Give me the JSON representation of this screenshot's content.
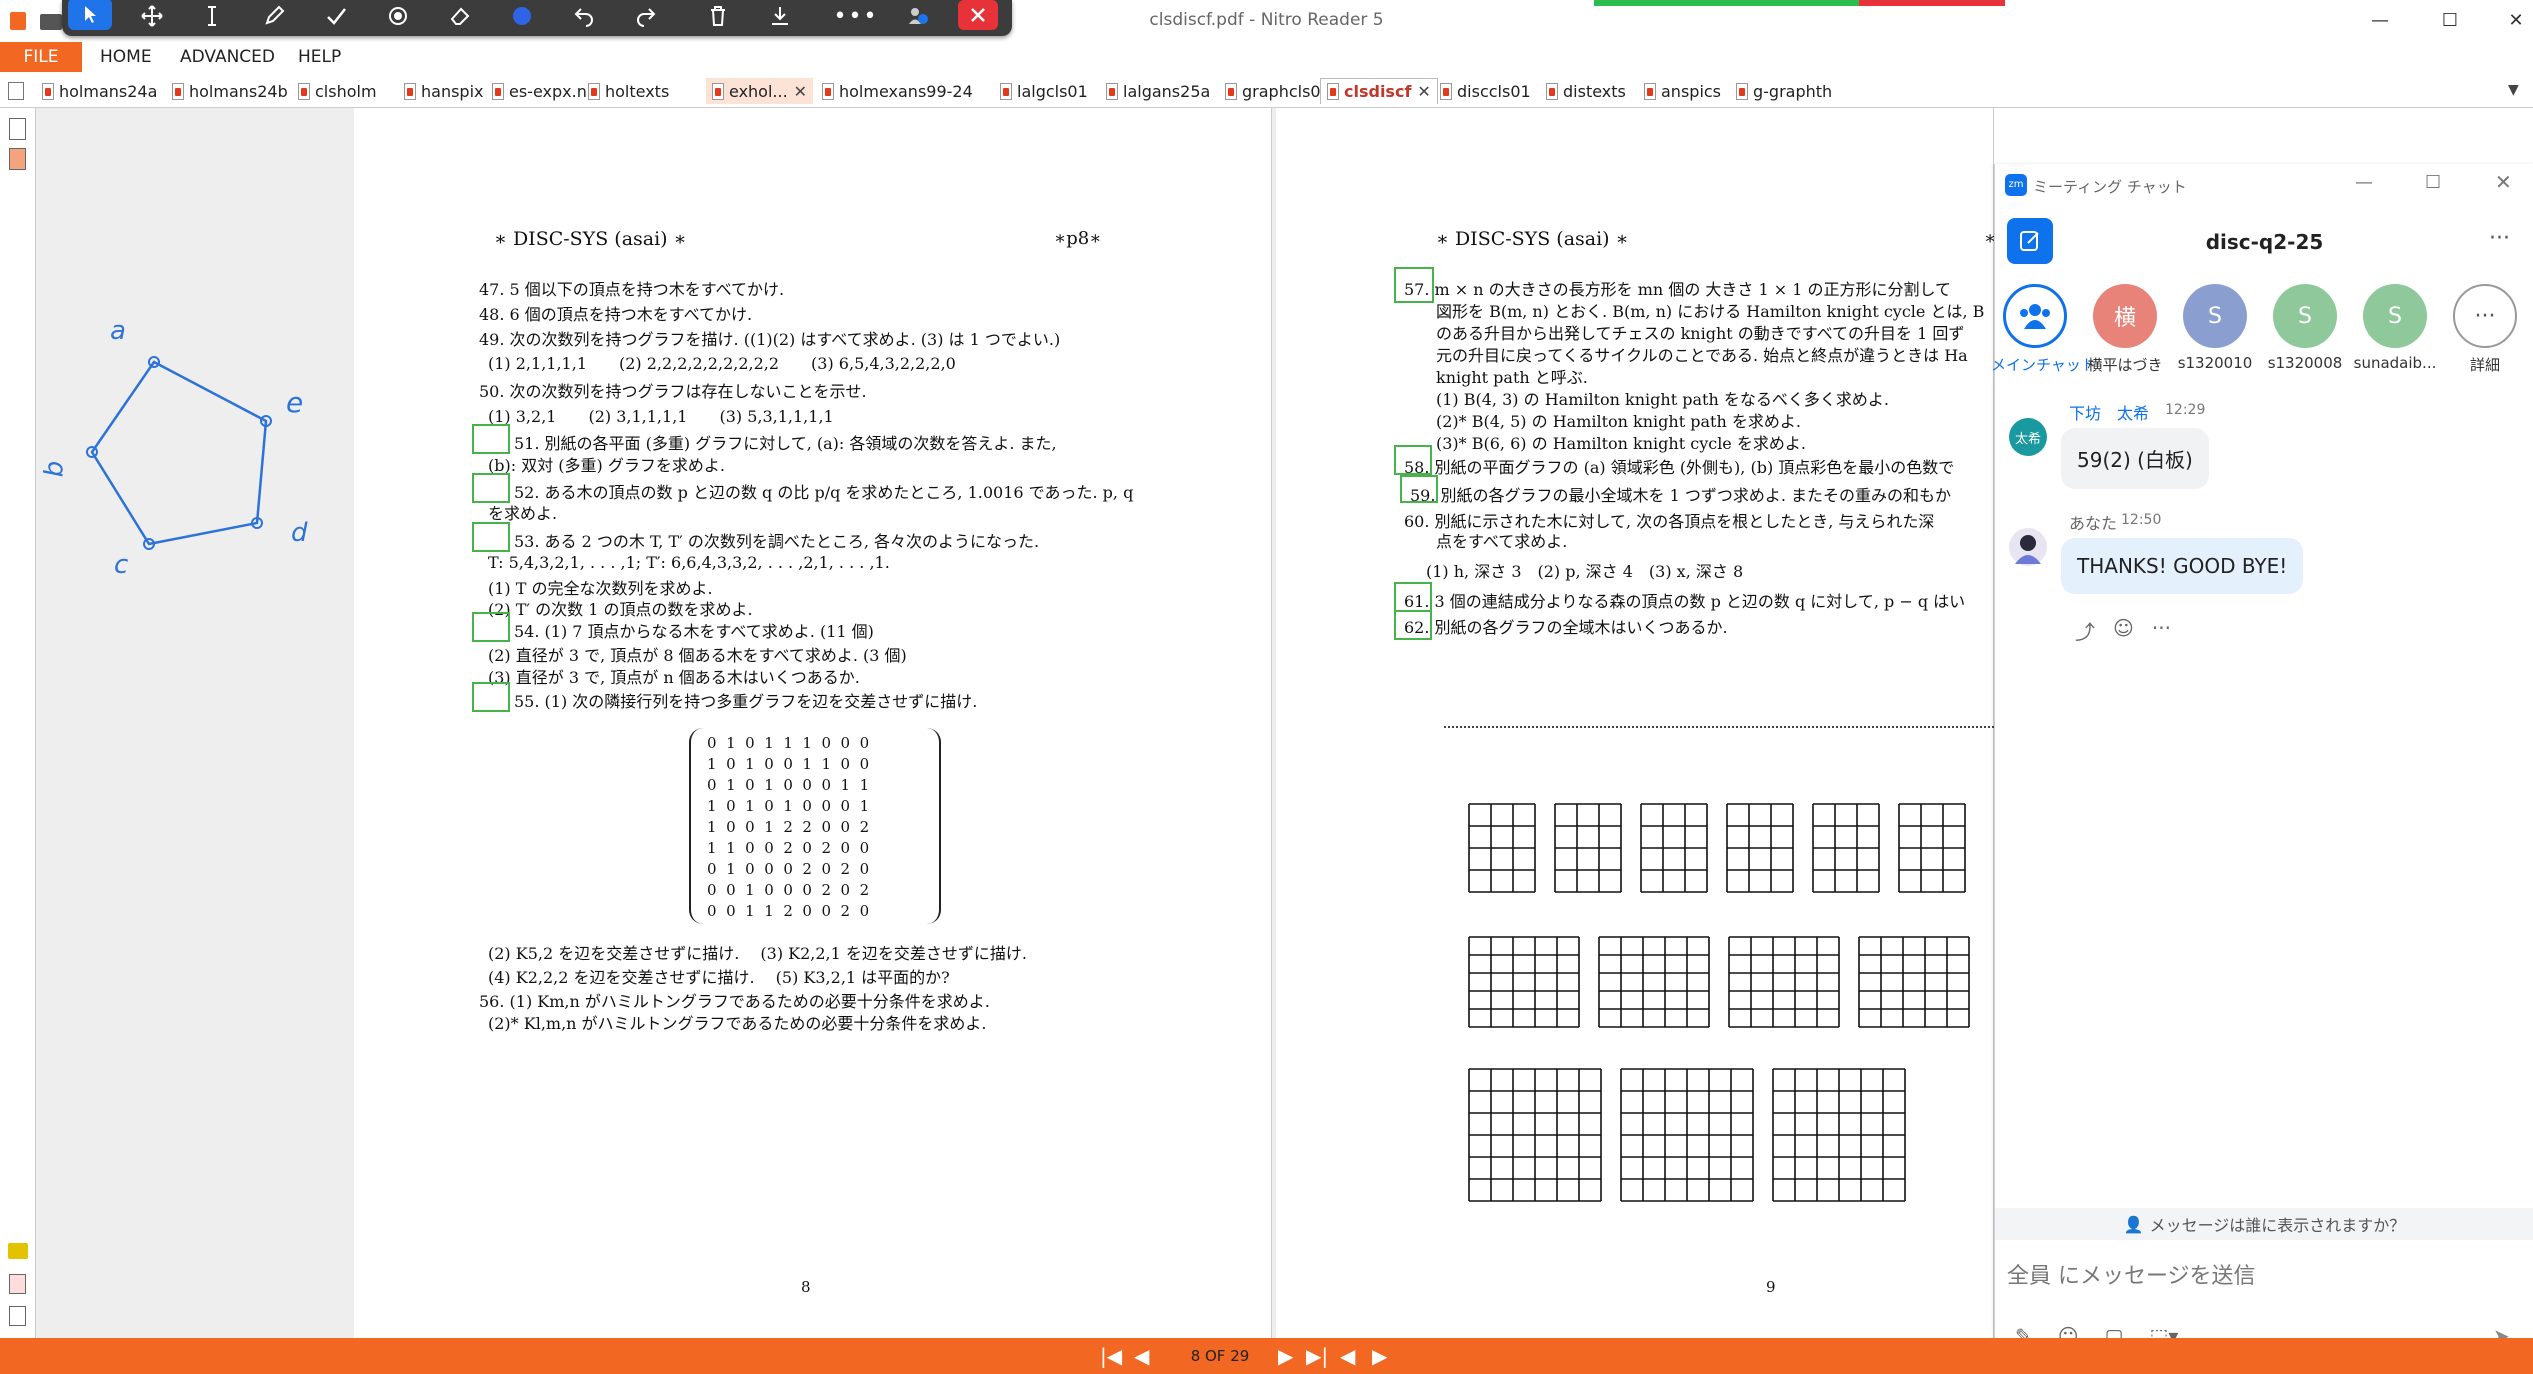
{
  "app": {
    "title": "clsdiscf.pdf - Nitro Reader 5"
  },
  "menu": {
    "file": "FILE",
    "items": [
      "HOME",
      "ADVANCED",
      "HELP"
    ]
  },
  "tabs": [
    {
      "label": "holmans24a",
      "active": false,
      "closable": false
    },
    {
      "label": "holmans24b",
      "active": false,
      "closable": false
    },
    {
      "label": "clsholm",
      "active": false,
      "closable": false
    },
    {
      "label": "hanspix",
      "active": false,
      "closable": false
    },
    {
      "label": "es-expx.nb",
      "active": false,
      "closable": false
    },
    {
      "label": "holtexts",
      "active": false,
      "closable": false
    },
    {
      "label": "exhol...",
      "active": false,
      "closable": true
    },
    {
      "label": "holmexans99-24",
      "active": false,
      "closable": false
    },
    {
      "label": "lalgcls01",
      "active": false,
      "closable": false
    },
    {
      "label": "lalgans25a",
      "active": false,
      "closable": false
    },
    {
      "label": "graphcls01",
      "active": false,
      "closable": false
    },
    {
      "label": "clsdiscf",
      "active": true,
      "closable": true
    },
    {
      "label": "disccls01",
      "active": false,
      "closable": false
    },
    {
      "label": "distexts",
      "active": false,
      "closable": false
    },
    {
      "label": "anspics",
      "active": false,
      "closable": false
    },
    {
      "label": "g-graphth",
      "active": false,
      "closable": false
    }
  ],
  "annotation_toolbar": {
    "tools": [
      "select-icon",
      "move-icon",
      "text-cursor-icon",
      "pen-icon",
      "check-icon",
      "stamp-icon",
      "eraser-icon",
      "color-dot-icon",
      "undo-icon",
      "redo-icon",
      "trash-icon",
      "download-icon",
      "more-icon",
      "share-screen-icon",
      "close-icon"
    ]
  },
  "handwriting": {
    "labels": [
      "a",
      "e",
      "d",
      "c",
      "b"
    ]
  },
  "page8": {
    "header_left": "∗ DISC-SYS (asai) ∗",
    "header_right": "∗p8∗",
    "lines": [
      "47. 5 個以下の頂点を持つ木をすべてかけ.",
      "48. 6 個の頂点を持つ木をすべてかけ.",
      "49. 次の次数列を持つグラフを描け. ((1)(2) はすべて求めよ. (3) は 1 つでよい.)",
      "(1) 2,1,1,1,1　　(2) 2,2,2,2,2,2,2,2,2　　(3) 6,5,4,3,2,2,2,0",
      "50. 次の次数列を持つグラフは存在しないことを示せ.",
      "(1) 3,2,1　　(2) 3,1,1,1,1　　(3) 5,3,1,1,1,1",
      "51. 別紙の各平面 (多重) グラフに対して, (a): 各領域の次数を答えよ. また,",
      "(b): 双対 (多重) グラフを求めよ.",
      "52. ある木の頂点の数 p と辺の数 q の比 p/q を求めたところ, 1.0016 であった. p, q",
      "を求めよ.",
      "53. ある 2 つの木 T, T′ の次数列を調べたところ, 各々次のようになった.",
      "T: 5,4,3,2,1, . . . ,1; T′: 6,6,4,3,3,2, . . . ,2,1, . . . ,1.",
      "(1) T の完全な次数列を求めよ.",
      "(2) T′ の次数 1 の頂点の数を求めよ.",
      "54. (1) 7 頂点からなる木をすべて求めよ. (11 個)",
      "(2) 直径が 3 で, 頂点が 8 個ある木をすべて求めよ. (3 個)",
      "(3) 直径が 3 で, 頂点が n 個ある木はいくつあるか.",
      "55. (1) 次の隣接行列を持つ多重グラフを辺を交差させずに描け.",
      "(2) K5,2 を辺を交差させずに描け.　 (3) K2,2,1 を辺を交差させずに描け.",
      "(4) K2,2,2 を辺を交差させずに描け.　 (5) K3,2,1 は平面的か?",
      "56. (1) Km,n がハミルトングラフであるための必要十分条件を求めよ.",
      "(2)* Kl,m,n がハミルトングラフであるための必要十分条件を求めよ."
    ],
    "matrix": [
      "0  1  0  1  1  1  0  0  0",
      "1  0  1  0  0  1  1  0  0",
      "0  1  0  1  0  0  0  1  1",
      "1  0  1  0  1  0  0  0  1",
      "1  0  0  1  2  2  0  0  2",
      "1  1  0  0  2  0  2  0  0",
      "0  1  0  0  0  2  0  2  0",
      "0  0  1  0  0  0  2  0  2",
      "0  0  1  1  2  0  0  2  0"
    ],
    "page_number": "8"
  },
  "page9": {
    "header_left": "∗ DISC-SYS (asai) ∗",
    "header_right": "∗",
    "lines": [
      "57. m × n の大きさの長方形を mn 個の 大きさ 1 × 1 の正方形に分割して",
      "図形を B(m, n) とおく. B(m, n) における Hamilton knight cycle とは, B",
      "のある升目から出発してチェスの knight の動きですべての升目を 1 回ず",
      "元の升目に戻ってくるサイクルのことである. 始点と終点が違うときは Ha",
      "knight path と呼ぶ.",
      "(1) B(4, 3) の Hamilton knight path をなるべく多く求めよ.",
      "(2)* B(4, 5) の Hamilton knight path を求めよ.",
      "(3)* B(6, 6) の Hamilton knight cycle を求めよ.",
      "58. 別紙の平面グラフの (a) 領域彩色 (外側も), (b) 頂点彩色を最小の色数で",
      "59. 別紙の各グラフの最小全域木を 1 つずつ求めよ. またその重みの和もか",
      "60. 別紙に示された木に対して, 次の各頂点を根としたとき, 与えられた深",
      "点をすべて求めよ.",
      "(1) h, 深さ 3　(2) p, 深さ 4　(3) x, 深さ 8",
      "61. 3 個の連結成分よりなる森の頂点の数 p と辺の数 q に対して, p − q はい",
      "62. 別紙の各グラフの全域木はいくつあるか."
    ],
    "page_number": "9"
  },
  "navigation": {
    "page_indicator": "8 OF 29"
  },
  "chat": {
    "window_title": "ミーティング チャット",
    "channel": "disc-q2-25",
    "participants": [
      {
        "label": "メインチャット",
        "initial": "",
        "color": "#0e72ed"
      },
      {
        "label": "横平はづき",
        "initial": "横",
        "color": "#e8837a"
      },
      {
        "label": "s1320010",
        "initial": "S",
        "color": "#8a9ecf"
      },
      {
        "label": "s1320008",
        "initial": "S",
        "color": "#8fc89a"
      },
      {
        "label": "sunadaib...",
        "initial": "S",
        "color": "#8fc89a"
      },
      {
        "label": "詳細",
        "initial": "···",
        "color": "#ffffff"
      }
    ],
    "messages": [
      {
        "sender": "下坊　太希",
        "time": "12:29",
        "avatar_text": "太希",
        "avatar_color": "#1a9aa0",
        "text": "59(2) (白板)"
      },
      {
        "sender": "あなた",
        "time": "12:50",
        "avatar_text": "",
        "avatar_color": "#ffffff",
        "text": "THANKS! GOOD BYE!"
      }
    ],
    "visibility_note": "メッセージは誰に表示されますか？",
    "input_placeholder": "全員 にメッセージを送信"
  }
}
